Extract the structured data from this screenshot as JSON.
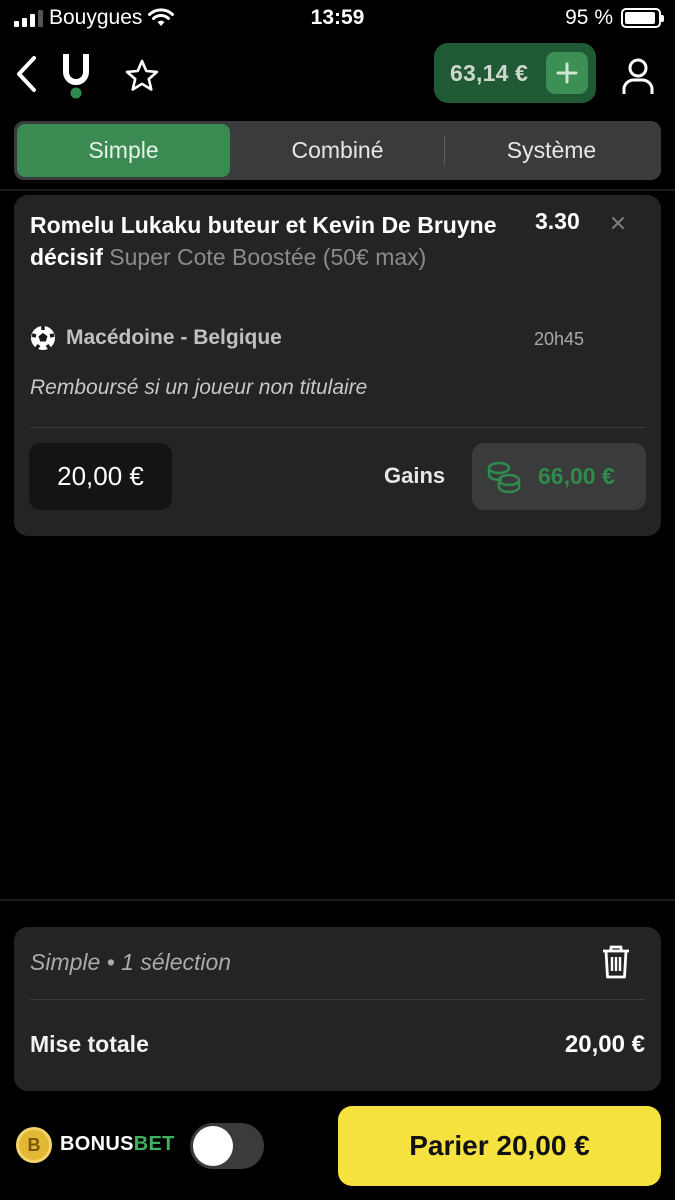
{
  "status_bar": {
    "carrier": "Bouygues",
    "time": "13:59",
    "battery": "95 %"
  },
  "top_nav": {
    "balance": "63,14 €",
    "icons": [
      "back-chevron-icon",
      "logo-icon",
      "star-icon",
      "plus-icon",
      "user-icon"
    ]
  },
  "tabs": [
    {
      "label": "Simple",
      "active": true
    },
    {
      "label": "Combiné",
      "active": false
    },
    {
      "label": "Système",
      "active": false
    }
  ],
  "bet": {
    "title": "Romelu Lukaku buteur et Kevin De Bruyne décisif",
    "boost": "Super Cote Boostée (50€ max)",
    "odds": "3.30",
    "match": "Macédoine - Belgique",
    "time": "20h45",
    "note": "Remboursé si un joueur non titulaire",
    "stake": "20,00 €",
    "gains_label": "Gains",
    "gains": "66,00 €"
  },
  "summary": {
    "title": "Simple • 1 sélection",
    "total_label": "Mise totale",
    "total_value": "20,00 €"
  },
  "bottom": {
    "bonus_coin": "B",
    "bonus_part1": "BONUS",
    "bonus_part2": "BET",
    "toggle_on": false,
    "place_bet": "Parier 20,00 €"
  },
  "colors": {
    "accent_green": "#3a8a52",
    "balance_bg": "#1f5a34",
    "gains_green": "#2f8a4e",
    "cta_yellow": "#f6e23e",
    "card_bg": "#232524"
  }
}
